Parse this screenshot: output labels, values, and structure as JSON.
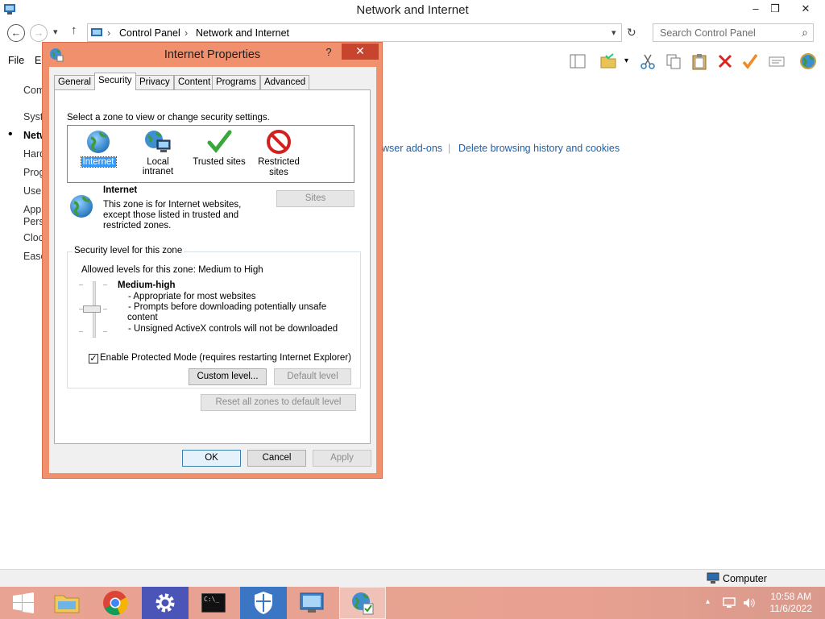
{
  "window": {
    "title": "Network and Internet",
    "minimize": "–",
    "maximize": "❒",
    "close": "✕"
  },
  "address_bar": {
    "back": "←",
    "forward": "→",
    "dropdown": "▾",
    "up": "↑",
    "crumbs": [
      "Control Panel",
      "Network and Internet"
    ],
    "separator": "›",
    "refresh": "↻",
    "search_placeholder": "Search Control Panel",
    "search_icon": "⌕"
  },
  "menu": {
    "file": "File",
    "edit_partial": "E"
  },
  "left_nav": {
    "bullet": "•",
    "items": [
      "Com",
      "Syste",
      "Netw",
      "Hard",
      "Prog",
      "User",
      "App",
      "Pers",
      "Cloc",
      "Ease"
    ]
  },
  "links": {
    "browser_addons_partial": "wser add-ons",
    "delete_history": "Delete browsing history and cookies"
  },
  "dialog": {
    "title": "Internet Properties",
    "help": "?",
    "close": "✕",
    "tabs": [
      "General",
      "Security",
      "Privacy",
      "Content",
      "Programs",
      "Advanced"
    ],
    "active_tab": "Security",
    "zone_prompt": "Select a zone to view or change security settings.",
    "zones": [
      {
        "label": "Internet",
        "icon": "globe-icon"
      },
      {
        "label": "Local intranet",
        "icon": "intranet-icon"
      },
      {
        "label": "Trusted sites",
        "icon": "check-icon"
      },
      {
        "label": "Restricted sites",
        "label_line1": "Restricted",
        "label_line2": "sites",
        "icon": "restricted-icon"
      }
    ],
    "selected_zone": "Internet",
    "zone_name": "Internet",
    "zone_desc_lines": [
      "This zone is for Internet websites,",
      "except those listed in trusted and",
      "restricted zones."
    ],
    "sites_button": "Sites",
    "security_group_label": "Security level for this zone",
    "allowed_levels": "Allowed levels for this zone: Medium to High",
    "level_name": "Medium-high",
    "level_bullets": [
      "- Appropriate for most websites",
      "- Prompts before downloading potentially unsafe",
      "content",
      "- Unsigned ActiveX controls will not be downloaded"
    ],
    "protected_mode_label": "Enable Protected Mode (requires restarting Internet Explorer)",
    "protected_mode_checked": true,
    "check_mark": "✓",
    "custom_level_button": "Custom level...",
    "default_level_button": "Default level",
    "reset_zones_button": "Reset all zones to default level",
    "ok_button": "OK",
    "cancel_button": "Cancel",
    "apply_button": "Apply"
  },
  "status_bar": {
    "computer_label": "Computer"
  },
  "taskbar": {
    "clock_time": "10:58 AM",
    "clock_date": "11/6/2022",
    "tray_caret": "▴",
    "apps": [
      "start",
      "file-explorer",
      "chrome",
      "settings",
      "command-prompt",
      "defender",
      "control-panel",
      "internet-options"
    ]
  },
  "colors": {
    "dialog_frame": "#f1906c",
    "close_button": "#c7442f",
    "taskbar": "#e9a392",
    "link": "#1e5fa8",
    "selection": "#3399ff"
  }
}
